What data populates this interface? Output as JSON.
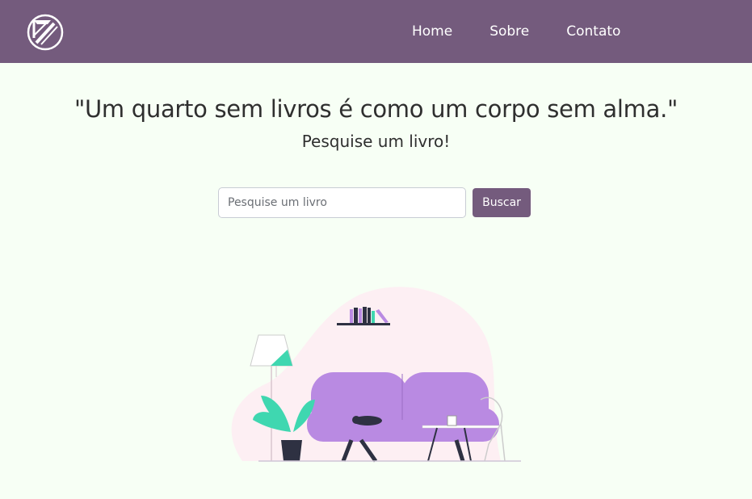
{
  "header": {
    "logo_icon": "book-arrow-logo-icon",
    "nav": [
      {
        "label": "Home"
      },
      {
        "label": "Sobre"
      },
      {
        "label": "Contato"
      }
    ]
  },
  "main": {
    "quote": "\"Um quarto sem livros é como um corpo sem alma.\"",
    "subtitle": "Pesquise um livro!",
    "search": {
      "placeholder": "Pesquise um livro",
      "value": "",
      "button_label": "Buscar"
    }
  },
  "colors": {
    "header_bg": "#745b7d",
    "page_bg": "#f7fff5",
    "button_bg": "#745b7d",
    "sofa": "#b98ae2",
    "plant": "#3fd7b0",
    "blob": "#fdeff3"
  }
}
